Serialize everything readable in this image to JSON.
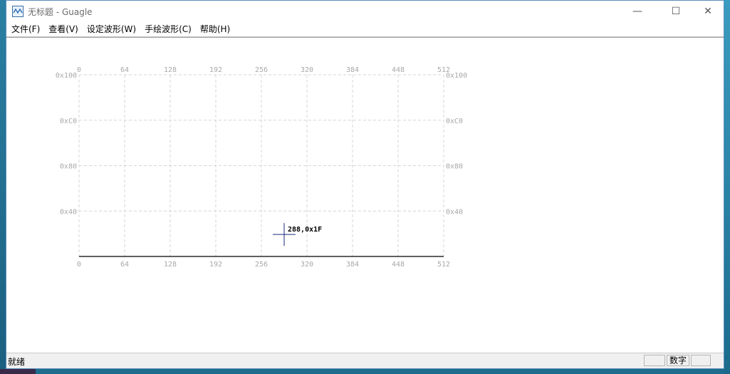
{
  "window": {
    "title": "无标题 - Guagle",
    "minimize_glyph": "—",
    "maximize_glyph": "☐",
    "close_glyph": "✕"
  },
  "menu": [
    {
      "label": "文件(F)"
    },
    {
      "label": "查看(V)"
    },
    {
      "label": "设定波形(W)"
    },
    {
      "label": "手绘波形(C)"
    },
    {
      "label": "帮助(H)"
    }
  ],
  "chart_data": {
    "type": "line",
    "x_ticks": [
      0,
      64,
      128,
      192,
      256,
      320,
      384,
      448,
      512
    ],
    "y_ticks": [
      {
        "value": 64,
        "label": "0x40"
      },
      {
        "value": 128,
        "label": "0x80"
      },
      {
        "value": 192,
        "label": "0xC0"
      },
      {
        "value": 256,
        "label": "0x100"
      }
    ],
    "xlim": [
      0,
      512
    ],
    "ylim": [
      0,
      256
    ],
    "grid": true,
    "grid_style": "dashed",
    "series": [
      {
        "x": [
          0,
          512
        ],
        "y": [
          0,
          0
        ],
        "color": "#000000"
      }
    ],
    "cursor": {
      "x": 288,
      "y": 31,
      "label": "288,0x1F"
    },
    "colors": {
      "grid": "#d6d6d6",
      "tick_text": "#a8a8a8",
      "trace": "#000000",
      "cursor": "#1a2a7a"
    }
  },
  "statusbar": {
    "text": "就绪",
    "pane_numlock": "数字"
  }
}
